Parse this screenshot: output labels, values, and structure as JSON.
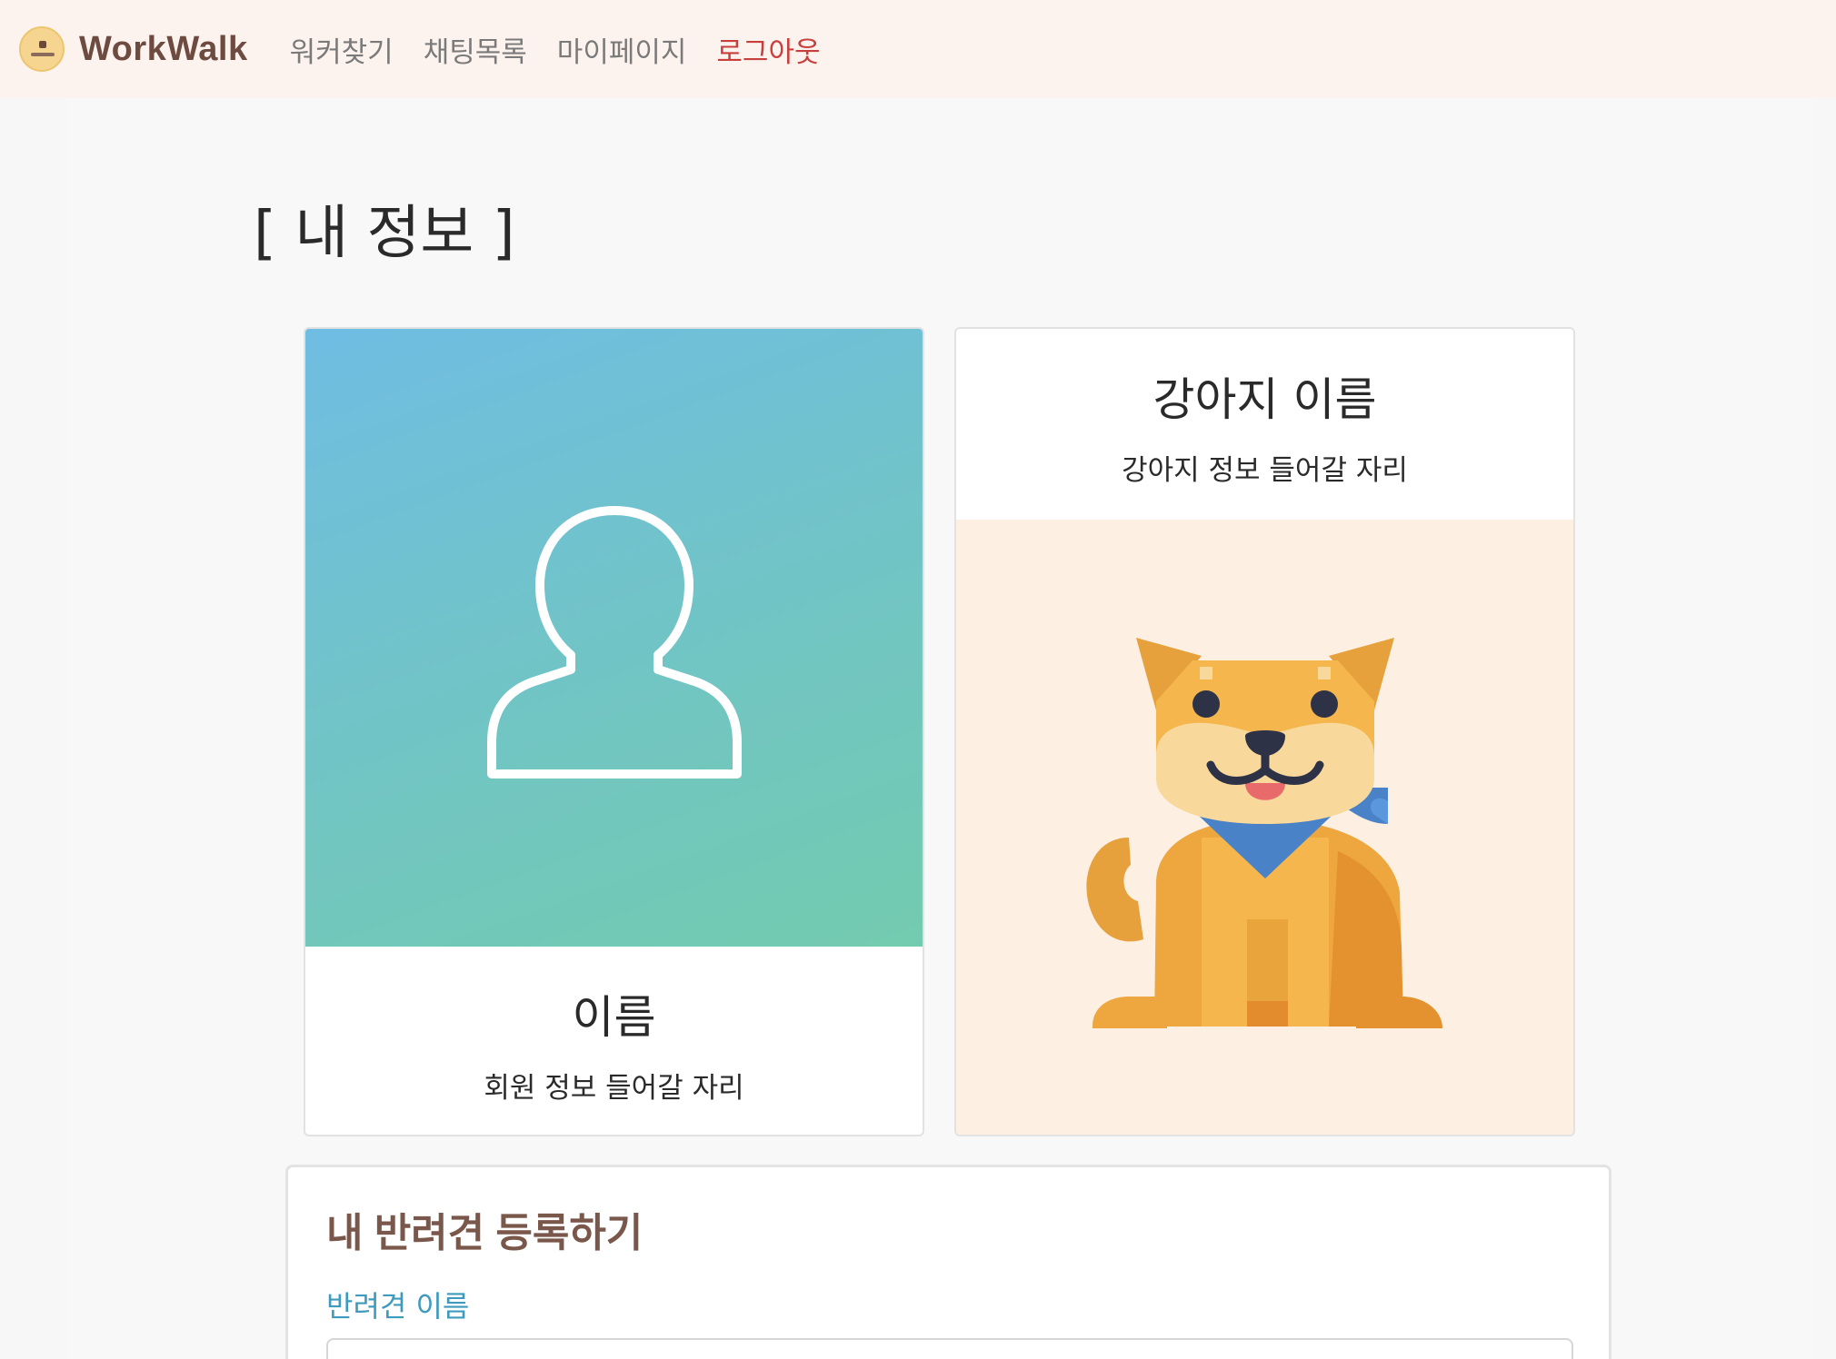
{
  "navbar": {
    "brand": "WorkWalk",
    "links": [
      "워커찾기",
      "채팅목록",
      "마이페이지"
    ],
    "logout": "로그아웃"
  },
  "page": {
    "title": "[ 내 정보 ]"
  },
  "user_card": {
    "name": "이름",
    "desc": "회원 정보 들어갈 자리"
  },
  "dog_card": {
    "name": "강아지 이름",
    "desc": "강아지 정보 들어갈 자리"
  },
  "register_form": {
    "title": "내 반려견 등록하기",
    "name_label": "반려견 이름",
    "name_value": ""
  },
  "colors": {
    "accent": "#c8403e",
    "brand": "#6e4b40",
    "label": "#3e9bbd"
  }
}
